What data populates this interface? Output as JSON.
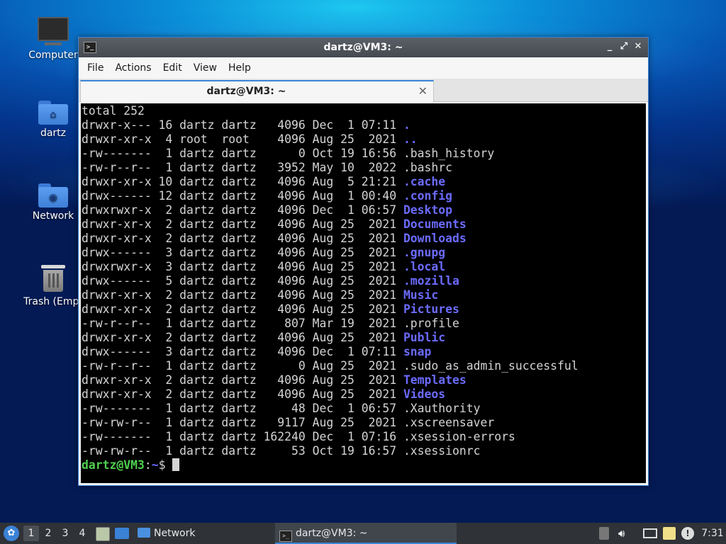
{
  "desktop": {
    "icons": [
      {
        "label": "Computer",
        "icon": "computer-icon"
      },
      {
        "label": "dartz",
        "icon": "home-folder-icon"
      },
      {
        "label": "Network",
        "icon": "network-folder-icon"
      },
      {
        "label": "Trash (Empt",
        "icon": "trash-icon"
      }
    ]
  },
  "window": {
    "title": "dartz@VM3: ~",
    "controls": {
      "minimize": "_",
      "maximize": "⤢",
      "close": "✕"
    },
    "menu": [
      "File",
      "Edit",
      "View",
      "Help"
    ],
    "menu_actions": "Actions",
    "tab": {
      "label": "dartz@VM3: ~",
      "close": "✕"
    }
  },
  "terminal": {
    "header": "total 252",
    "rows": [
      {
        "meta": "drwxr-x--- 16 dartz dartz   4096 Dec  1 07:11 ",
        "name": ".",
        "dir": true
      },
      {
        "meta": "drwxr-xr-x  4 root  root    4096 Aug 25  2021 ",
        "name": "..",
        "dir": true
      },
      {
        "meta": "-rw-------  1 dartz dartz      0 Oct 19 16:56 ",
        "name": ".bash_history",
        "dir": false
      },
      {
        "meta": "-rw-r--r--  1 dartz dartz   3952 May 10  2022 ",
        "name": ".bashrc",
        "dir": false
      },
      {
        "meta": "drwxr-xr-x 10 dartz dartz   4096 Aug  5 21:21 ",
        "name": ".cache",
        "dir": true
      },
      {
        "meta": "drwx------ 12 dartz dartz   4096 Aug  1 00:40 ",
        "name": ".config",
        "dir": true
      },
      {
        "meta": "drwxrwxr-x  2 dartz dartz   4096 Dec  1 06:57 ",
        "name": "Desktop",
        "dir": true
      },
      {
        "meta": "drwxr-xr-x  2 dartz dartz   4096 Aug 25  2021 ",
        "name": "Documents",
        "dir": true
      },
      {
        "meta": "drwxr-xr-x  2 dartz dartz   4096 Aug 25  2021 ",
        "name": "Downloads",
        "dir": true
      },
      {
        "meta": "drwx------  3 dartz dartz   4096 Aug 25  2021 ",
        "name": ".gnupg",
        "dir": true
      },
      {
        "meta": "drwxrwxr-x  3 dartz dartz   4096 Aug 25  2021 ",
        "name": ".local",
        "dir": true
      },
      {
        "meta": "drwx------  5 dartz dartz   4096 Aug 25  2021 ",
        "name": ".mozilla",
        "dir": true
      },
      {
        "meta": "drwxr-xr-x  2 dartz dartz   4096 Aug 25  2021 ",
        "name": "Music",
        "dir": true
      },
      {
        "meta": "drwxr-xr-x  2 dartz dartz   4096 Aug 25  2021 ",
        "name": "Pictures",
        "dir": true
      },
      {
        "meta": "-rw-r--r--  1 dartz dartz    807 Mar 19  2021 ",
        "name": ".profile",
        "dir": false
      },
      {
        "meta": "drwxr-xr-x  2 dartz dartz   4096 Aug 25  2021 ",
        "name": "Public",
        "dir": true
      },
      {
        "meta": "drwx------  3 dartz dartz   4096 Dec  1 07:11 ",
        "name": "snap",
        "dir": true
      },
      {
        "meta": "-rw-r--r--  1 dartz dartz      0 Aug 25  2021 ",
        "name": ".sudo_as_admin_successful",
        "dir": false
      },
      {
        "meta": "drwxr-xr-x  2 dartz dartz   4096 Aug 25  2021 ",
        "name": "Templates",
        "dir": true
      },
      {
        "meta": "drwxr-xr-x  2 dartz dartz   4096 Aug 25  2021 ",
        "name": "Videos",
        "dir": true
      },
      {
        "meta": "-rw-------  1 dartz dartz     48 Dec  1 06:57 ",
        "name": ".Xauthority",
        "dir": false
      },
      {
        "meta": "-rw-rw-r--  1 dartz dartz   9117 Aug 25  2021 ",
        "name": ".xscreensaver",
        "dir": false
      },
      {
        "meta": "-rw-------  1 dartz dartz 162240 Dec  1 07:16 ",
        "name": ".xsession-errors",
        "dir": false
      },
      {
        "meta": "-rw-rw-r--  1 dartz dartz     53 Oct 19 16:57 ",
        "name": ".xsessionrc",
        "dir": false
      }
    ],
    "prompt": {
      "user_host": "dartz@VM3",
      "colon": ":",
      "path": "~",
      "symbol": "$ "
    }
  },
  "taskbar": {
    "workspaces": [
      "1",
      "2",
      "3",
      "4"
    ],
    "active_workspace": "1",
    "network_label": "Network",
    "terminal_task": "dartz@VM3: ~",
    "clock": "7:31"
  },
  "colors": {
    "dir": "#6b6bff",
    "prompt_user": "#4fd04f",
    "accent": "#3a85d6"
  }
}
